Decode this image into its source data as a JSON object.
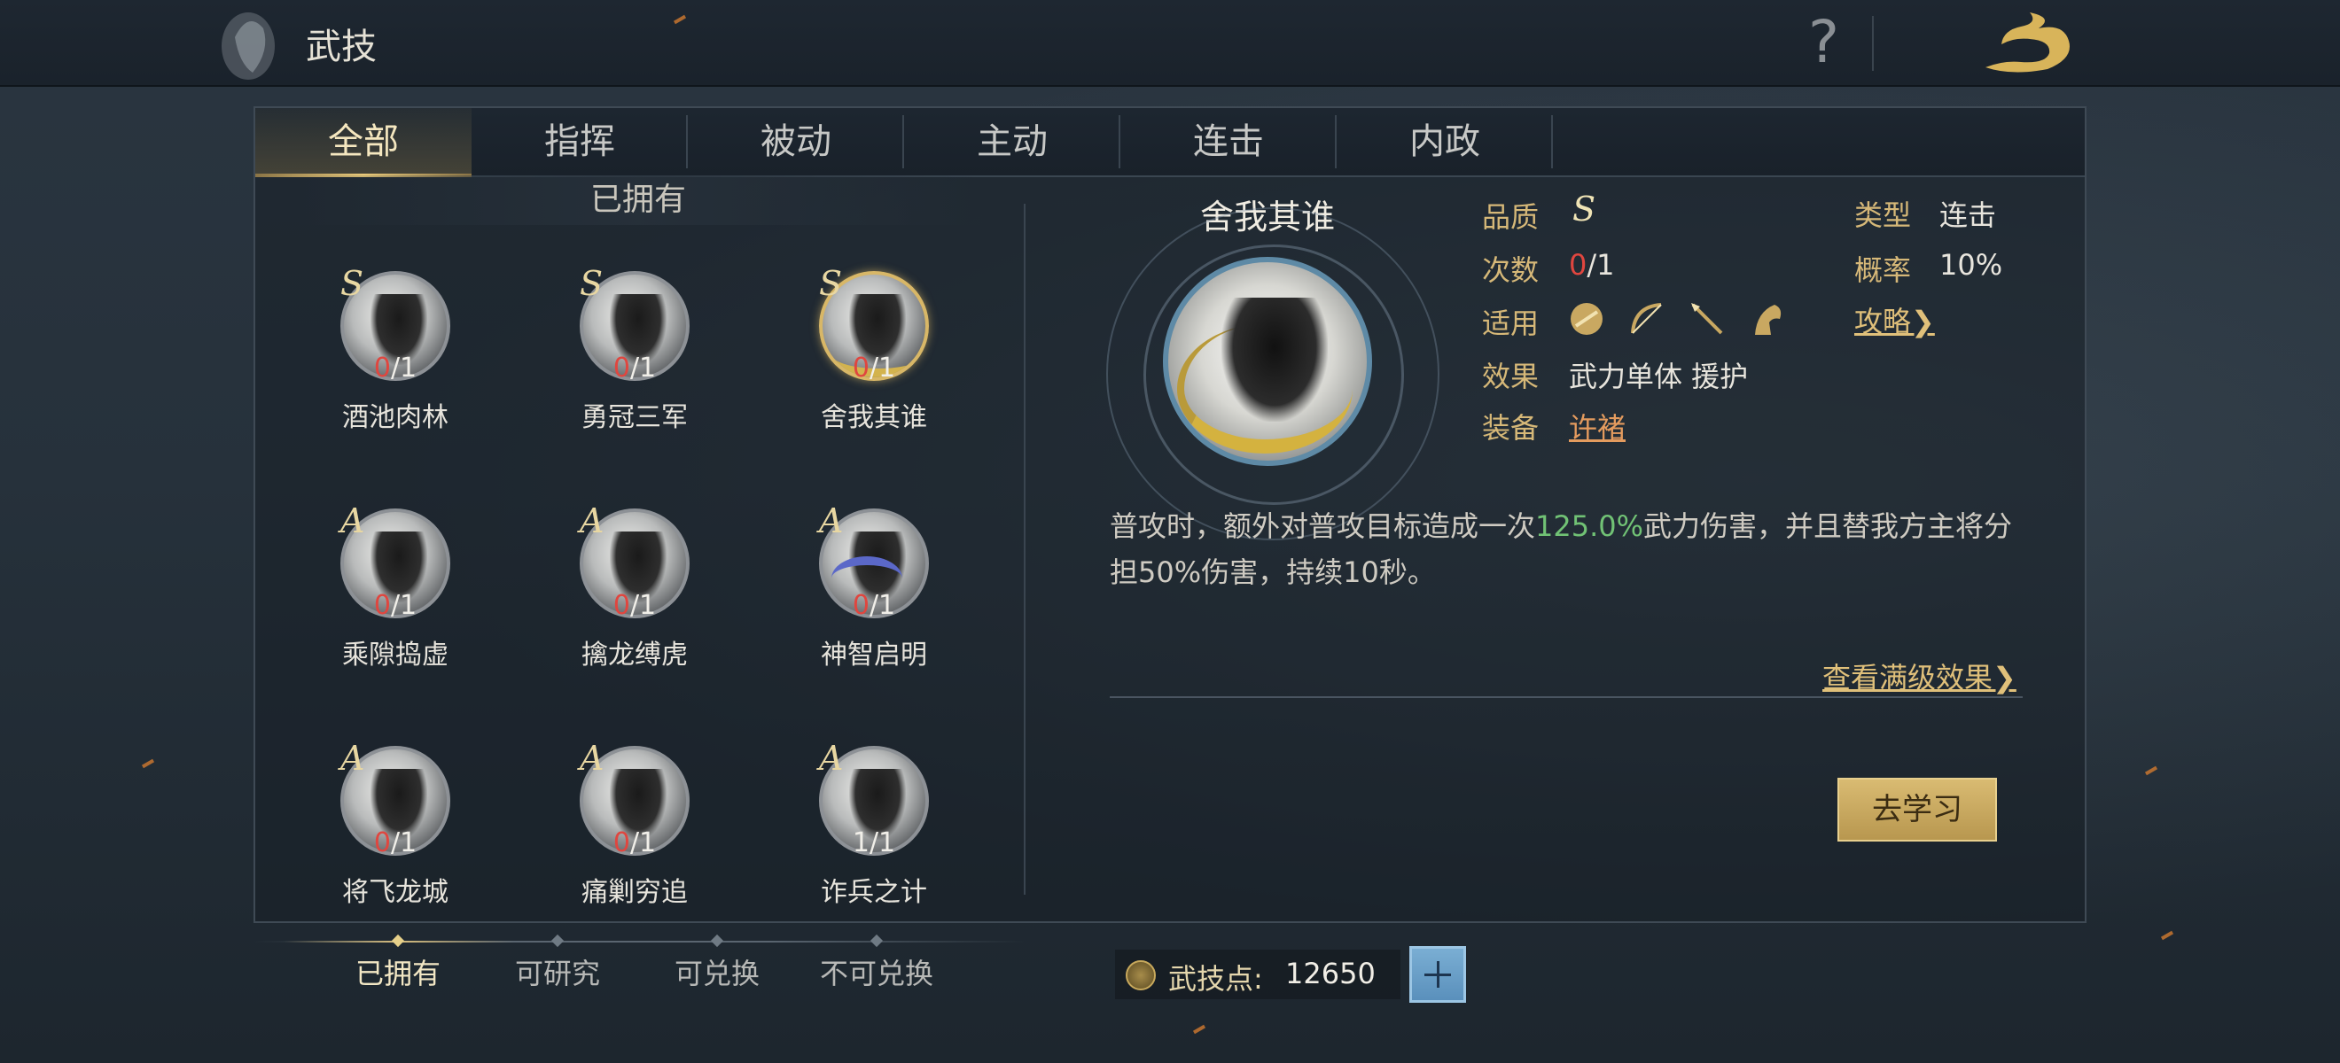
{
  "topbar": {
    "title": "武技",
    "help_label": "?"
  },
  "tabs": [
    {
      "label": "全部",
      "active": true
    },
    {
      "label": "指挥",
      "active": false
    },
    {
      "label": "被动",
      "active": false
    },
    {
      "label": "主动",
      "active": false
    },
    {
      "label": "连击",
      "active": false
    },
    {
      "label": "内政",
      "active": false
    }
  ],
  "owned_header": "已拥有",
  "skills": [
    {
      "grade": "S",
      "count_current": "0",
      "count_total": "/1",
      "name": "酒池肉林"
    },
    {
      "grade": "S",
      "count_current": "0",
      "count_total": "/1",
      "name": "勇冠三军"
    },
    {
      "grade": "S",
      "count_current": "0",
      "count_total": "/1",
      "name": "舍我其谁"
    },
    {
      "grade": "A",
      "count_current": "0",
      "count_total": "/1",
      "name": "乘隙捣虚"
    },
    {
      "grade": "A",
      "count_current": "0",
      "count_total": "/1",
      "name": "擒龙缚虎"
    },
    {
      "grade": "A",
      "count_current": "0",
      "count_total": "/1",
      "name": "神智启明"
    },
    {
      "grade": "A",
      "count_current": "0",
      "count_total": "/1",
      "name": "将飞龙城"
    },
    {
      "grade": "A",
      "count_current": "0",
      "count_total": "/1",
      "name": "痛剿穷追"
    },
    {
      "grade": "A",
      "count_current": "1",
      "count_total": "/1",
      "name": "诈兵之计"
    }
  ],
  "detail": {
    "name": "舍我其谁",
    "quality_label": "品质",
    "quality_value": "S",
    "type_label": "类型",
    "type_value": "连击",
    "times_label": "次数",
    "times_current": "0",
    "times_total": "/1",
    "rate_label": "概率",
    "rate_value": "10%",
    "apply_label": "适用",
    "apply_icons": [
      "shield-unit-icon",
      "bow-unit-icon",
      "spear-unit-icon",
      "cavalry-unit-icon"
    ],
    "guide_link": "攻略❯",
    "effect_label": "效果",
    "effect_value": "武力单体  援护",
    "equip_label": "装备",
    "equip_value": "许褚",
    "desc_part1": "普攻时，额外对普攻目标造成一次",
    "desc_highlight": "125.0%",
    "desc_part2": "武力伤害，并且替我方主将分担50%伤害，持续10秒。",
    "full_level_link": "查看满级效果❯",
    "learn_button": "去学习"
  },
  "filters": [
    {
      "label": "已拥有",
      "active": true
    },
    {
      "label": "可研究",
      "active": false
    },
    {
      "label": "可兑换",
      "active": false
    },
    {
      "label": "不可兑换",
      "active": false
    }
  ],
  "points": {
    "label": "武技点:",
    "value": "12650"
  },
  "colors": {
    "accent_gold": "#d6b878",
    "highlight_green": "#71c275",
    "count_red": "#e0463f"
  }
}
